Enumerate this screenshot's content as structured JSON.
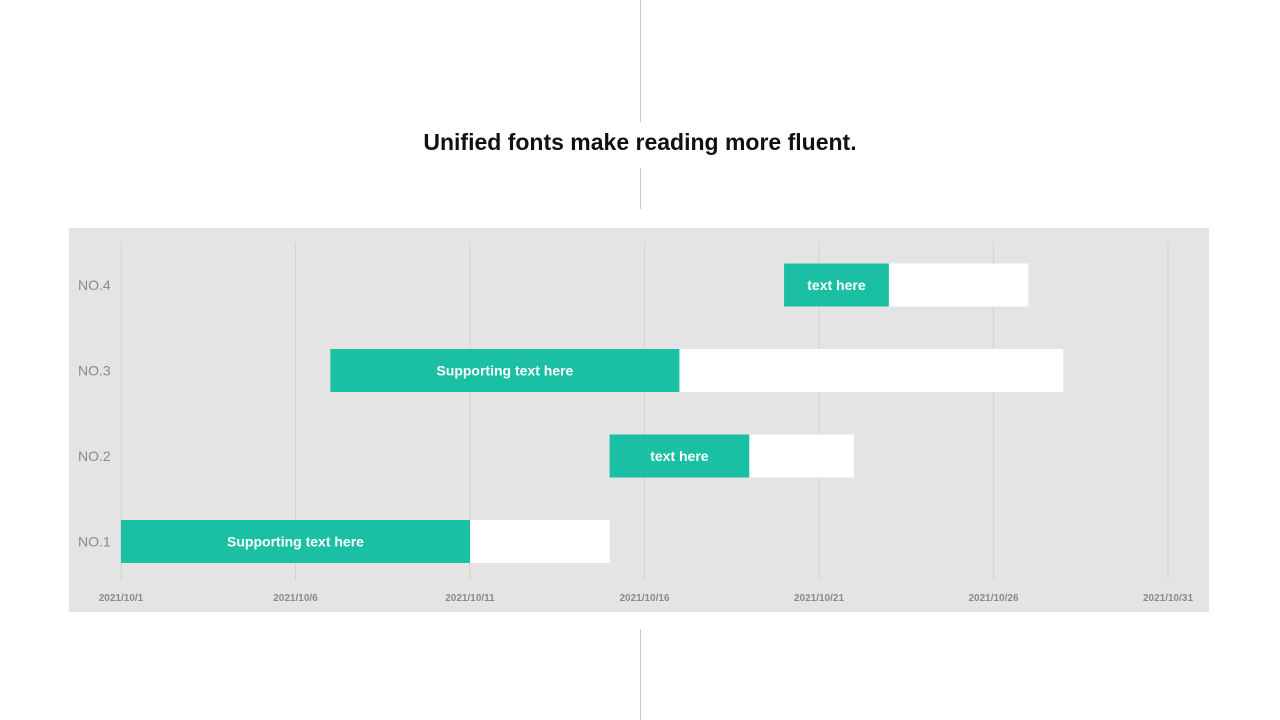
{
  "title": "Unified fonts make reading more fluent.",
  "colors": {
    "accent": "#1bbfa4",
    "remainder": "#ffffff",
    "panel": "#e4e4e4"
  },
  "chart_data": {
    "type": "bar",
    "orientation": "horizontal-gantt",
    "xlim": [
      "2021/10/1",
      "2021/10/31"
    ],
    "x_ticks": [
      "2021/10/1",
      "2021/10/6",
      "2021/10/11",
      "2021/10/16",
      "2021/10/21",
      "2021/10/26",
      "2021/10/31"
    ],
    "grid": true,
    "tasks": [
      {
        "label": "NO.1",
        "start": "2021/10/1",
        "progress_end": "2021/10/11",
        "end": "2021/10/15",
        "text": "Supporting text here"
      },
      {
        "label": "NO.2",
        "start": "2021/10/15",
        "progress_end": "2021/10/19",
        "end": "2021/10/22",
        "text": "text here"
      },
      {
        "label": "NO.3",
        "start": "2021/10/7",
        "progress_end": "2021/10/17",
        "end": "2021/10/28",
        "text": "Supporting text here"
      },
      {
        "label": "NO.4",
        "start": "2021/10/20",
        "progress_end": "2021/10/23",
        "end": "2021/10/27",
        "text": "text here"
      }
    ]
  }
}
